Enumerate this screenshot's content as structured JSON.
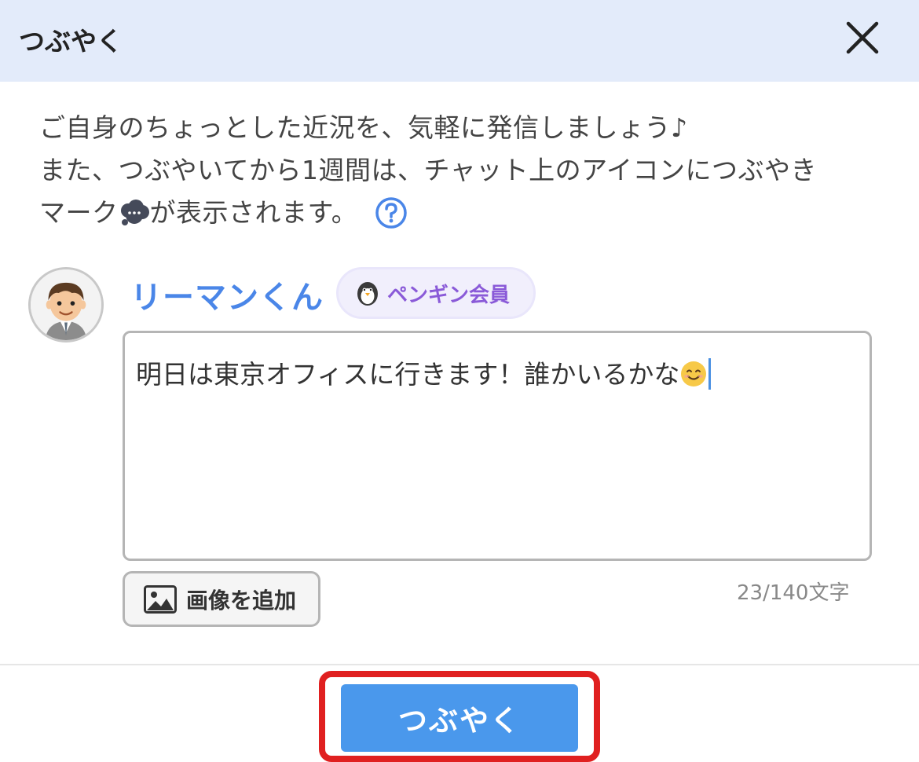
{
  "header": {
    "title": "つぶやく",
    "close_icon": "close-icon"
  },
  "description": {
    "line1": "ご自身のちょっとした近況を、気軽に発信しましょう♪",
    "line2": "また、つぶやいてから1週間は、チャット上のアイコンにつぶやき",
    "line3_before": "マーク",
    "line3_after": "が表示されます。",
    "bubble_icon": "speech-bubble-icon",
    "help_icon": "question-mark-icon"
  },
  "user": {
    "name": "リーマンくん",
    "badge": "ペンギン会員",
    "badge_icon": "penguin-icon"
  },
  "composer": {
    "text": "明日は東京オフィスに行きます！誰かいるかな",
    "emoji": "smiling-face-icon"
  },
  "add_image": {
    "label": "画像を追加",
    "icon": "image-icon"
  },
  "char_count": "23/140文字",
  "submit": {
    "label": "つぶやく"
  },
  "colors": {
    "header_bg": "#e3ebfa",
    "accent": "#4a86e8",
    "button": "#4a98ec",
    "badge_text": "#8a5ad8",
    "highlight": "#e02020"
  }
}
